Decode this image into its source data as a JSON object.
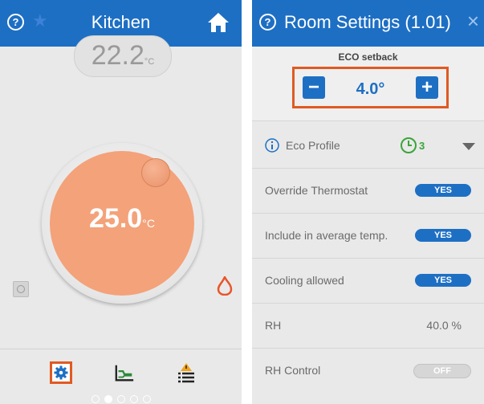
{
  "left": {
    "title": "Kitchen",
    "help_glyph": "?",
    "current_temp": "22.2",
    "current_temp_unit": "°C",
    "set_temp": "25.0",
    "set_temp_unit": "°C",
    "page_count": 5,
    "active_page": 2
  },
  "right": {
    "title": "Room Settings (1.01)",
    "help_glyph": "?",
    "close_glyph": "×",
    "eco": {
      "label": "ECO setback",
      "minus": "−",
      "value": "4.0°",
      "plus": "+"
    },
    "eco_profile": {
      "label": "Eco Profile",
      "value": "3"
    },
    "rows": [
      {
        "label": "Override Thermostat",
        "toggle": "YES"
      },
      {
        "label": "Include in average temp.",
        "toggle": "YES"
      },
      {
        "label": "Cooling allowed",
        "toggle": "YES"
      },
      {
        "label": "RH",
        "value": "40.0 %"
      },
      {
        "label": "RH Control",
        "toggle": "OFF"
      }
    ]
  },
  "colors": {
    "header_blue": "#1d6fc4",
    "highlight_orange": "#e05a22",
    "dial_orange": "#f4a27a",
    "eco_green": "#3aa53a",
    "flame_orange": "#e8552a"
  },
  "icons": [
    "help-icon",
    "star-icon",
    "home-icon",
    "flame-icon",
    "settings-icon",
    "chart-icon",
    "alert-list-icon",
    "info-icon",
    "clock-icon",
    "dropdown-caret-icon",
    "close-icon"
  ]
}
